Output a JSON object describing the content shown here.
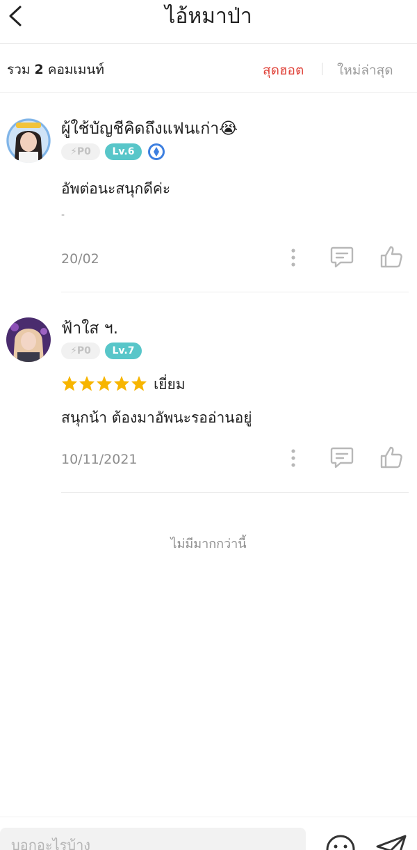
{
  "header": {
    "title": "ไอ้หมาป่า"
  },
  "subbar": {
    "total_prefix": "รวม",
    "total_count": "2",
    "total_suffix": "คอมเมนท์",
    "sort_hot": "สุดฮอต",
    "sort_new": "ใหม่ล่าสุด"
  },
  "comments": [
    {
      "username": "ผู้ใช้บัญชีคิดถึงแฟนเก่า😭",
      "points": "P0",
      "level": "Lv.6",
      "text": "อัพต่อนะสนุกดีค่ะ",
      "extra": "-",
      "date": "20/02"
    },
    {
      "username": "ฟ้าใส ฯ.",
      "points": "P0",
      "level": "Lv.7",
      "rating_stars": 5,
      "rating_label": "เยี่ยม",
      "text": "สนุกน้า ต้องมาอัพนะรออ่านอยู่",
      "date": "10/11/2021"
    }
  ],
  "footer_note": "ไม่มีมากกว่านี้",
  "composer": {
    "placeholder": "บอกอะไรบ้าง"
  },
  "colors": {
    "accent_red": "#e0443b",
    "level_teal": "#58c6c9",
    "star_yellow": "#f7b500",
    "muted_gray": "#8d8d8d"
  }
}
